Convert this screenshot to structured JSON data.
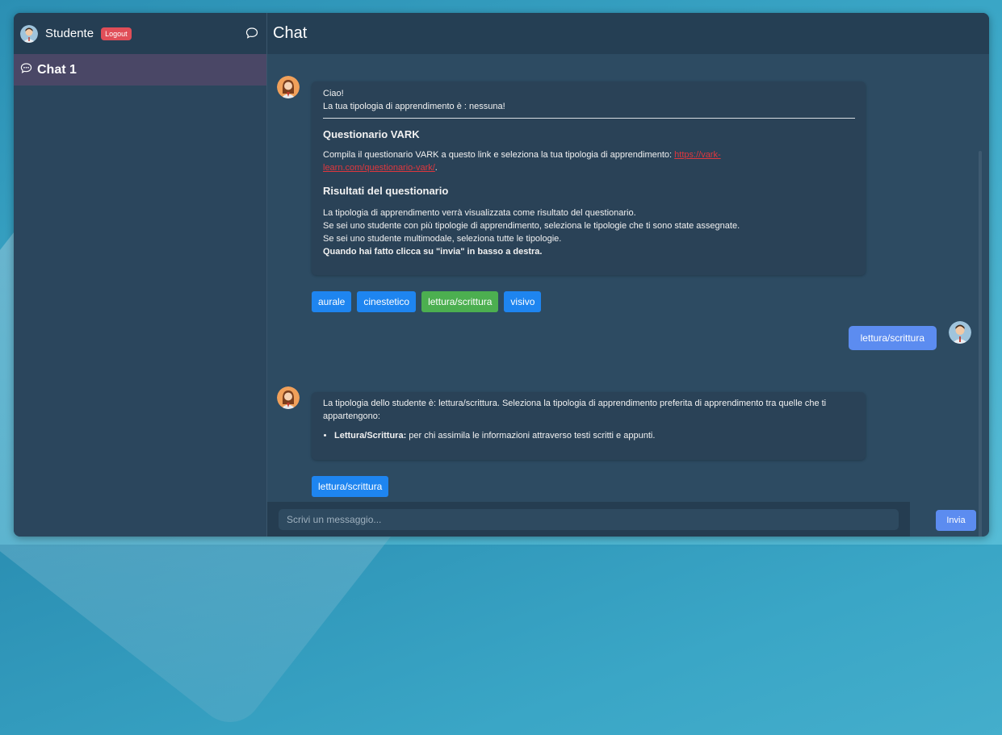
{
  "sidebar": {
    "user_name": "Studente",
    "logout_label": "Logout",
    "chats": [
      {
        "label": "Chat 1"
      }
    ]
  },
  "main": {
    "title": "Chat"
  },
  "messages": {
    "bot1": {
      "greeting": "Ciao!",
      "typology_line": "La tua tipologia di apprendimento è : nessuna!",
      "section1_title": "Questionario VARK",
      "section1_text": "Compila il questionario VARK a questo link e seleziona la tua tipologia di apprendimento: ",
      "section1_link": "https://vark-learn.com/questionario-vark/",
      "section1_after": ".",
      "section2_title": "Risultati del questionario",
      "section2_lines": [
        "La tipologia di apprendimento verrà visualizzata come risultato del questionario.",
        "Se sei uno studente con più tipologie di apprendimento, seleziona le tipologie che ti sono state assegnate.",
        "Se sei uno studente multimodale, seleziona tutte le tipologie."
      ],
      "section2_bold": "Quando hai fatto clicca su \"invia\" in basso a destra."
    },
    "options1": [
      {
        "label": "aurale",
        "selected": false
      },
      {
        "label": "cinestetico",
        "selected": false
      },
      {
        "label": "lettura/scrittura",
        "selected": true
      },
      {
        "label": "visivo",
        "selected": false
      }
    ],
    "user1": "lettura/scrittura",
    "bot2": {
      "text": "La tipologia dello studente è: lettura/scrittura. Seleziona la tipologia di apprendimento preferita di apprendimento tra quelle che ti appartengono:",
      "item_bold": "Lettura/Scrittura:",
      "item_text": " per chi assimila le informazioni attraverso testi scritti e appunti."
    },
    "options2": [
      {
        "label": "lettura/scrittura"
      }
    ]
  },
  "input": {
    "placeholder": "Scrivi un messaggio...",
    "send_label": "Invia"
  },
  "colors": {
    "accent": "#1e85f0",
    "selected": "#4caf50",
    "logout": "#e04e58",
    "user_bubble": "#5c8cf0"
  }
}
